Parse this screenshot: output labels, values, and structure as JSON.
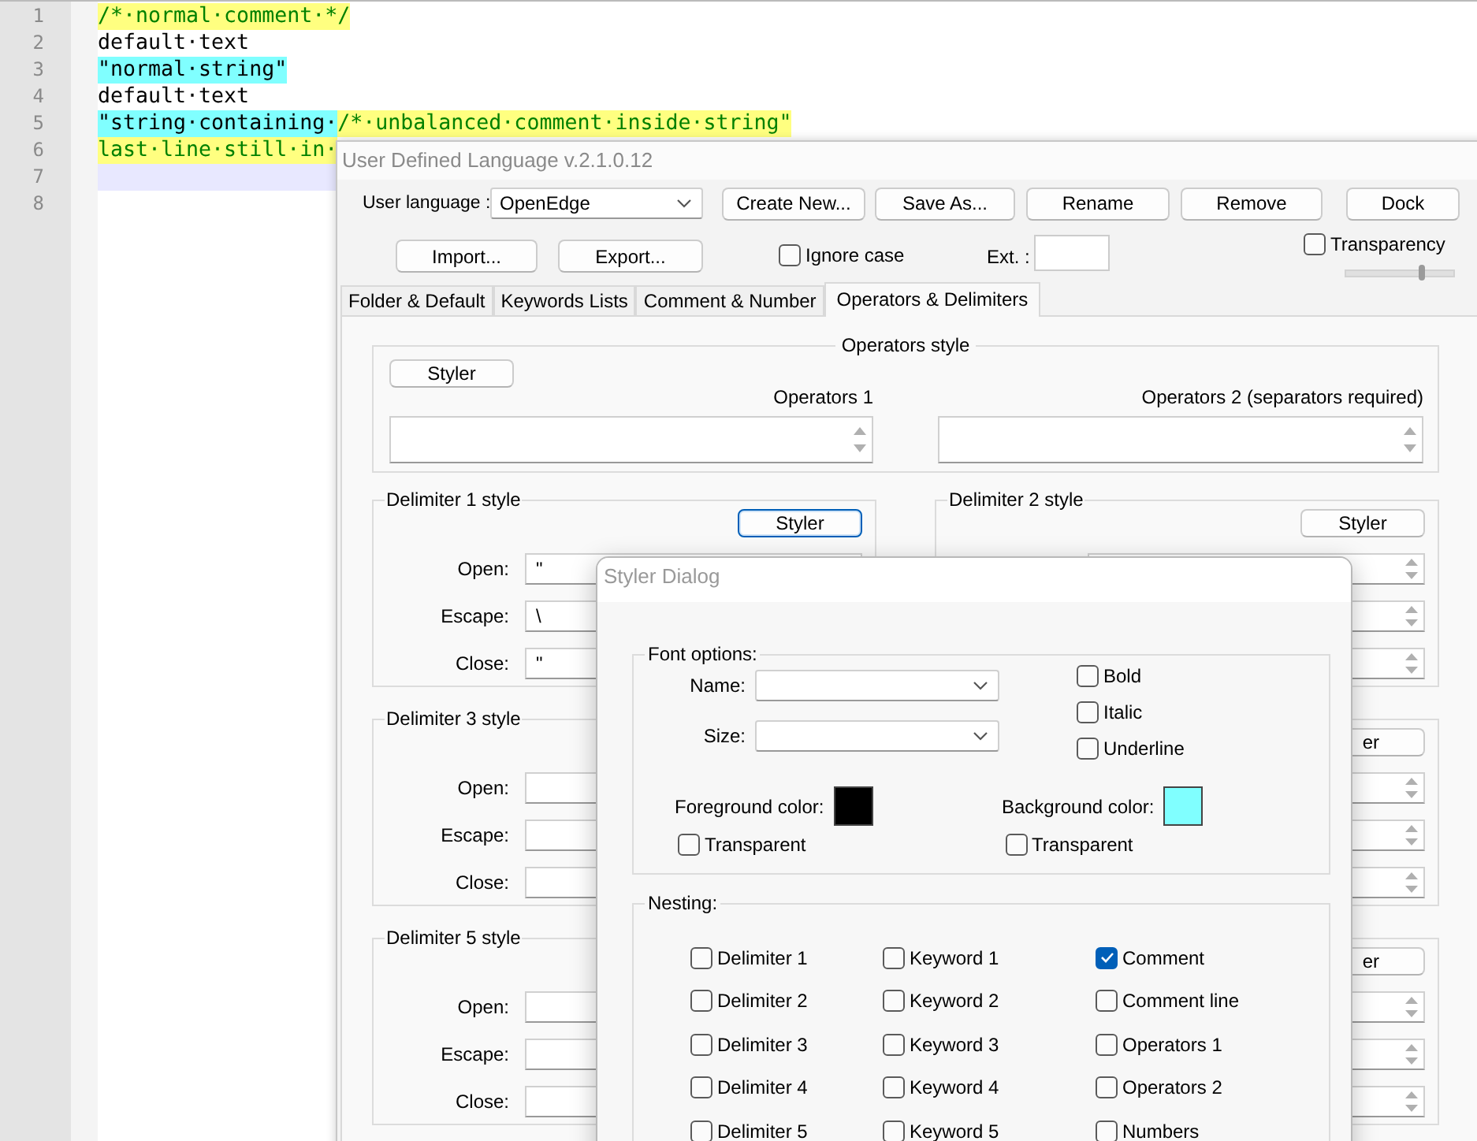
{
  "editor": {
    "lines": [
      {
        "number": "1",
        "current": false,
        "segments": [
          {
            "text": "/*·normal·comment·*/",
            "kind": "comment"
          }
        ]
      },
      {
        "number": "2",
        "current": false,
        "segments": [
          {
            "text": "default·text",
            "kind": "default"
          }
        ]
      },
      {
        "number": "3",
        "current": false,
        "segments": [
          {
            "text": "\"normal·string\"",
            "kind": "string"
          }
        ]
      },
      {
        "number": "4",
        "current": false,
        "segments": [
          {
            "text": "default·text",
            "kind": "default"
          }
        ]
      },
      {
        "number": "5",
        "current": false,
        "segments": [
          {
            "text": "\"string·containing·",
            "kind": "string"
          },
          {
            "text": "/*·unbalanced·comment·inside·string\"",
            "kind": "comment"
          }
        ]
      },
      {
        "number": "6",
        "current": false,
        "segments": [
          {
            "text": "last·line·still·in·",
            "kind": "comment"
          }
        ]
      },
      {
        "number": "7",
        "current": true
      },
      {
        "number": "8",
        "current": false
      }
    ]
  },
  "udl_dialog": {
    "title": "User Defined Language v.2.1.0.12",
    "language_label": "User language :",
    "language_value": "OpenEdge",
    "top_buttons": [
      "Create New...",
      "Save As...",
      "Rename",
      "Remove",
      "Dock"
    ],
    "import_button": "Import...",
    "export_button": "Export...",
    "ignore_case": {
      "label": "Ignore case",
      "checked": false
    },
    "ext_label": "Ext. :",
    "transparency": {
      "label": "Transparency",
      "checked": false,
      "level": 0.7
    },
    "tabs": [
      {
        "label": "Folder & Default",
        "selected": false
      },
      {
        "label": "Keywords Lists",
        "selected": false
      },
      {
        "label": "Comment & Number",
        "selected": false
      },
      {
        "label": "Operators & Delimiters",
        "selected": true
      }
    ],
    "operators_style": {
      "title": "Operators style",
      "styler_button": "Styler",
      "operators1_label": "Operators 1",
      "operators2_label": "Operators 2 (separators required)"
    },
    "delimiter_groups": [
      {
        "title": "Delimiter 1 style",
        "styler_button": "Styler",
        "focused": true,
        "fields": [
          {
            "label": "Open:",
            "value": "\""
          },
          {
            "label": "Escape:",
            "value": "\\"
          },
          {
            "label": "Close:",
            "value": "\""
          }
        ]
      },
      {
        "title": "Delimiter 2 style",
        "styler_button": "Styler",
        "focused": false
      },
      {
        "title": "Delimiter 3 style",
        "fields": [
          {
            "label": "Open:"
          },
          {
            "label": "Escape:"
          },
          {
            "label": "Close:"
          }
        ]
      },
      {
        "styler_button": "er",
        "focused": false
      },
      {
        "title": "Delimiter 5 style",
        "fields": [
          {
            "label": "Open:"
          },
          {
            "label": "Escape:"
          },
          {
            "label": "Close:"
          }
        ]
      },
      {
        "styler_button": "er",
        "focused": false
      }
    ]
  },
  "styler_dialog": {
    "title": "Styler Dialog",
    "font_options": {
      "title": "Font options:",
      "name_label": "Name:",
      "size_label": "Size:",
      "styles": [
        {
          "label": "Bold",
          "checked": false
        },
        {
          "label": "Italic",
          "checked": false
        },
        {
          "label": "Underline",
          "checked": false
        }
      ],
      "colors": [
        {
          "label": "Foreground color:",
          "color": "#000000",
          "transparent": {
            "label": "Transparent",
            "checked": false
          }
        },
        {
          "label": "Background color:",
          "color": "#80ffff",
          "transparent": {
            "label": "Transparent",
            "checked": false
          }
        }
      ]
    },
    "nesting": {
      "title": "Nesting:",
      "items": [
        {
          "label": "Delimiter 1",
          "checked": false
        },
        {
          "label": "Keyword 1",
          "checked": false
        },
        {
          "label": "Comment",
          "checked": true
        },
        {
          "label": "Delimiter 2",
          "checked": false
        },
        {
          "label": "Keyword 2",
          "checked": false
        },
        {
          "label": "Comment line",
          "checked": false
        },
        {
          "label": "Delimiter 3",
          "checked": false
        },
        {
          "label": "Keyword 3",
          "checked": false
        },
        {
          "label": "Operators 1",
          "checked": false
        },
        {
          "label": "Delimiter 4",
          "checked": false
        },
        {
          "label": "Keyword 4",
          "checked": false
        },
        {
          "label": "Operators 2",
          "checked": false
        },
        {
          "label": "Delimiter 5",
          "checked": false
        },
        {
          "label": "Keyword 5",
          "checked": false
        },
        {
          "label": "Numbers",
          "checked": false
        }
      ]
    }
  }
}
